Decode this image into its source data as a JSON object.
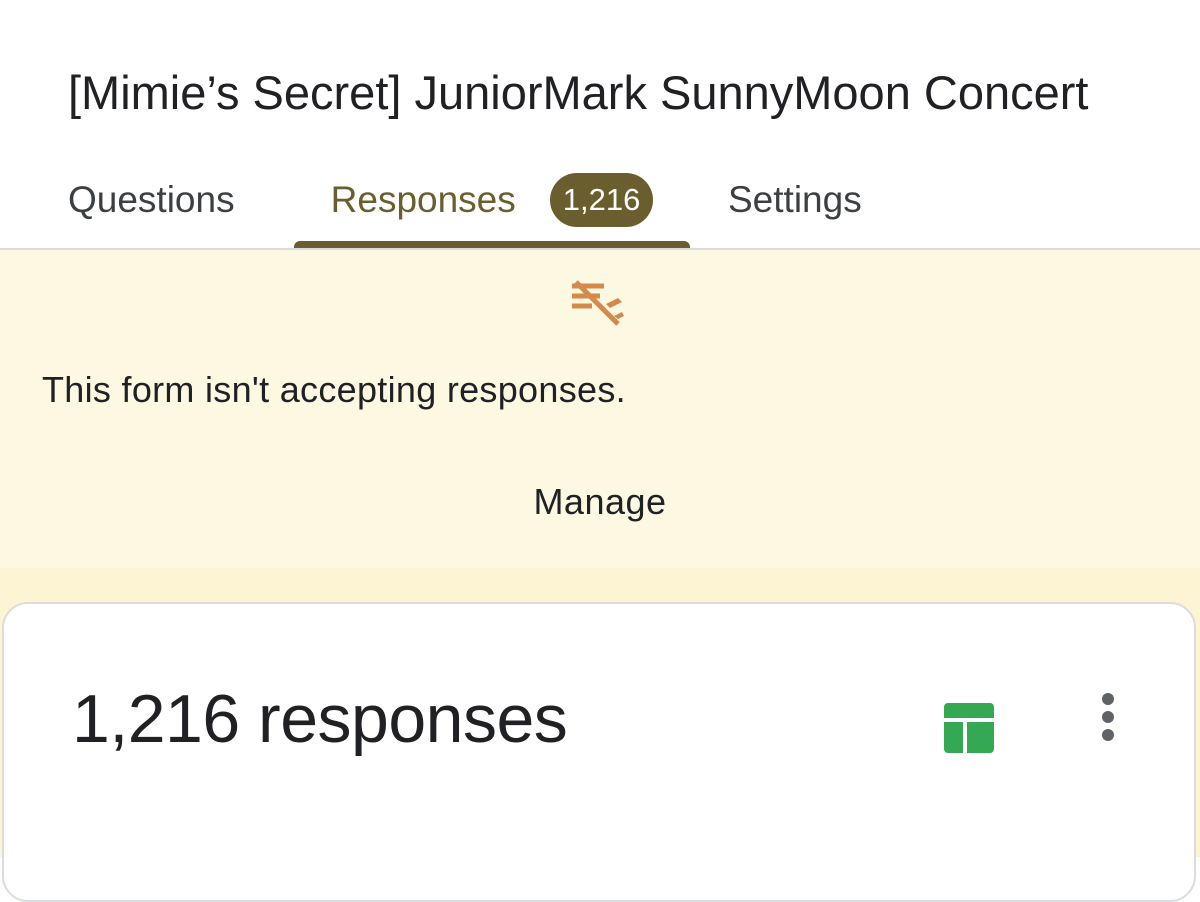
{
  "form": {
    "title": "[Mimie’s Secret] JuniorMark SunnyMoon Concert"
  },
  "tabs": [
    {
      "label": "Questions"
    },
    {
      "label": "Responses",
      "badge": "1,216",
      "active": true
    },
    {
      "label": "Settings"
    }
  ],
  "banner": {
    "icon": "responses-off-icon",
    "message": "This form isn't accepting responses.",
    "action_label": "Manage"
  },
  "summary": {
    "count_label": "1,216 responses",
    "sheets_icon": "google-sheets-icon",
    "menu_icon": "more-vert-icon"
  },
  "colors": {
    "accent": "#6b5e2e",
    "banner_background": "#fdf8e1",
    "banner_icon": "#d58a4c",
    "sheets_green": "#34a853",
    "page_background": "#fcf4d3"
  }
}
